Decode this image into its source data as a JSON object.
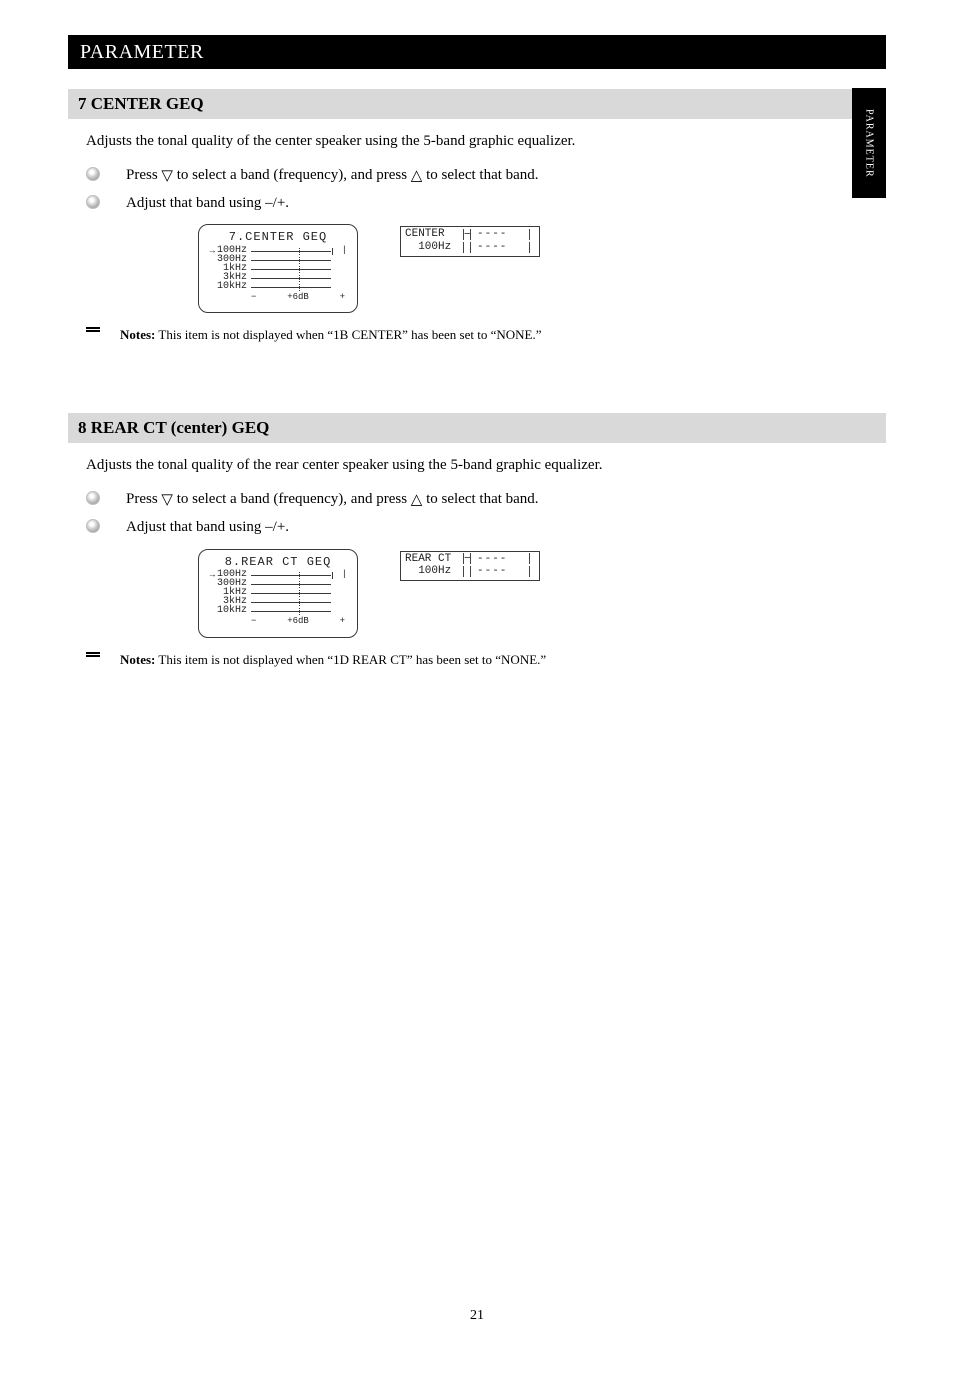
{
  "header": {
    "title": "PARAMETER"
  },
  "side_tab": "PARAMETER",
  "footer_page": "21",
  "sections": [
    {
      "bar": "7 CENTER GEQ",
      "intro": "Adjusts the tonal quality of the center speaker using the 5-band graphic equalizer.",
      "step1_pre": "Press ",
      "step1_mid_a": " to select a band (frequency), and press ",
      "step1_mid_b": " to select that band.",
      "step2": "Adjust that band using –/+.",
      "big_title": "7.CENTER GEQ",
      "small_r1": "CENTER",
      "small_r2": "  100Hz",
      "bands": [
        "100Hz",
        "300Hz",
        "1kHz",
        "3kHz",
        "10kHz"
      ],
      "scale_label": "+6dB",
      "scale_minus": "−",
      "scale_plus": "+",
      "note_prefix": "Notes:",
      "note_body": " This item is not displayed when “1B CENTER” has been set to “NONE.”"
    },
    {
      "bar": "8 REAR CT (center) GEQ",
      "intro": "Adjusts the tonal quality of the rear center speaker using the 5-band graphic equalizer.",
      "step1_pre": "Press ",
      "step1_mid_a": " to select a band (frequency), and press ",
      "step1_mid_b": " to select that band.",
      "step2": "Adjust that band using –/+.",
      "big_title": "8.REAR CT GEQ",
      "small_r1": "REAR CT",
      "small_r2": "  100Hz",
      "bands": [
        "100Hz",
        "300Hz",
        "1kHz",
        "3kHz",
        "10kHz"
      ],
      "scale_label": "+6dB",
      "scale_minus": "−",
      "scale_plus": "+",
      "note_prefix": "Notes:",
      "note_body": " This item is not displayed when “1D REAR CT” has been set to “NONE.”"
    }
  ]
}
